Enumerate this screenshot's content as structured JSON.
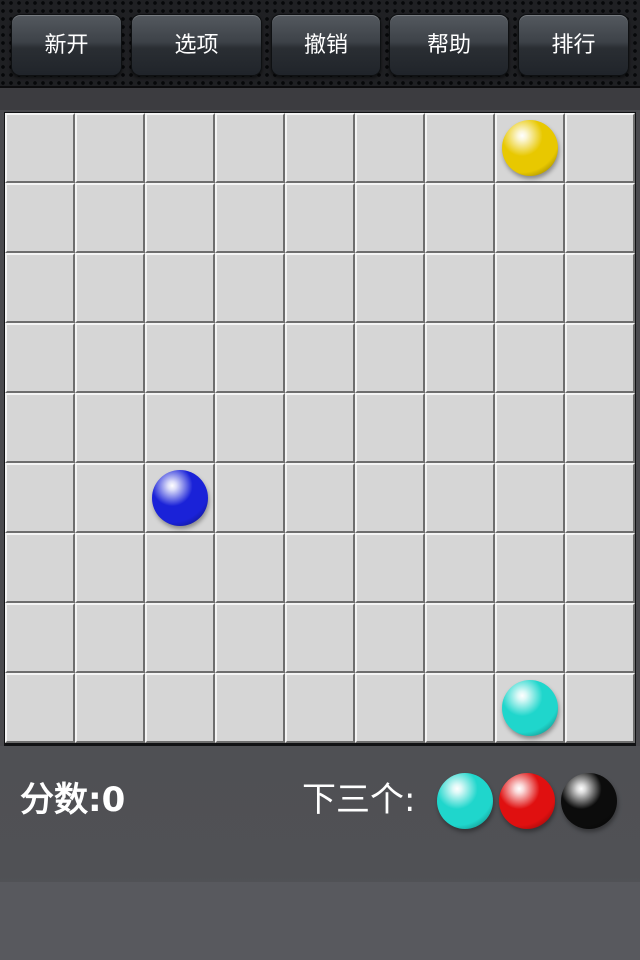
{
  "toolbar": {
    "buttons": [
      {
        "label": "新开"
      },
      {
        "label": "选项"
      },
      {
        "label": "撤销"
      },
      {
        "label": "帮助"
      },
      {
        "label": "排行"
      }
    ]
  },
  "board": {
    "rows": 9,
    "cols": 9,
    "balls": [
      {
        "row": 0,
        "col": 7,
        "color": "yellow"
      },
      {
        "row": 5,
        "col": 2,
        "color": "blue"
      },
      {
        "row": 8,
        "col": 7,
        "color": "cyan"
      }
    ]
  },
  "status": {
    "score_label": "分数:0",
    "next_label": "下三个:",
    "next_balls": [
      "cyan",
      "red",
      "black"
    ]
  },
  "colors": {
    "yellow": "#e8c800",
    "blue": "#1a22d8",
    "cyan": "#1fd6cc",
    "red": "#e01010",
    "black": "#0c0c0c"
  }
}
